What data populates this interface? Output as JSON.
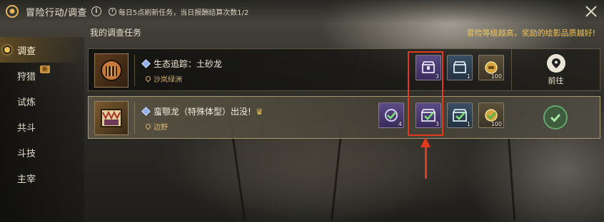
{
  "header": {
    "title": "冒险行动/调查",
    "refresh_text": "每日5点刷新任务，当日报酬结算次数1/2",
    "close_icon": "close-icon",
    "info_icon": "info-icon"
  },
  "sidebar": {
    "items": [
      {
        "label": "调查",
        "active": true
      },
      {
        "label": "狩猎",
        "badge": "新"
      },
      {
        "label": "试炼"
      },
      {
        "label": "共斗"
      },
      {
        "label": "斗技"
      },
      {
        "label": "主宰"
      }
    ]
  },
  "main": {
    "section_title": "我的调查任务",
    "hint": "冒险等级越高，奖励的绘影品质越好!",
    "quests": [
      {
        "name": "生态追踪：土砂龙",
        "location": "沙岚绿洲",
        "rewards": [
          {
            "icon": "purple-chest-icon",
            "count": "3"
          },
          {
            "icon": "blue-chest-icon",
            "count": "1"
          },
          {
            "icon": "gold-coin-icon",
            "count": "100"
          }
        ],
        "action_label": "前往",
        "action_icon": "map-pin-icon"
      },
      {
        "name": "蛮颚龙（特殊体型）出没!",
        "location": "边野",
        "rewards": [
          {
            "icon": "purple-orb-check-icon",
            "count": "4"
          },
          {
            "icon": "purple-chest-check-icon",
            "count": "3"
          },
          {
            "icon": "blue-chest-check-icon",
            "count": "1"
          },
          {
            "icon": "gold-coin-check-icon",
            "count": "100"
          }
        ],
        "status_icon": "completed-check-icon"
      }
    ]
  },
  "colors": {
    "accent_gold": "#f0c45c",
    "annotation_red": "#e4391f",
    "complete_green": "#62a86b"
  }
}
